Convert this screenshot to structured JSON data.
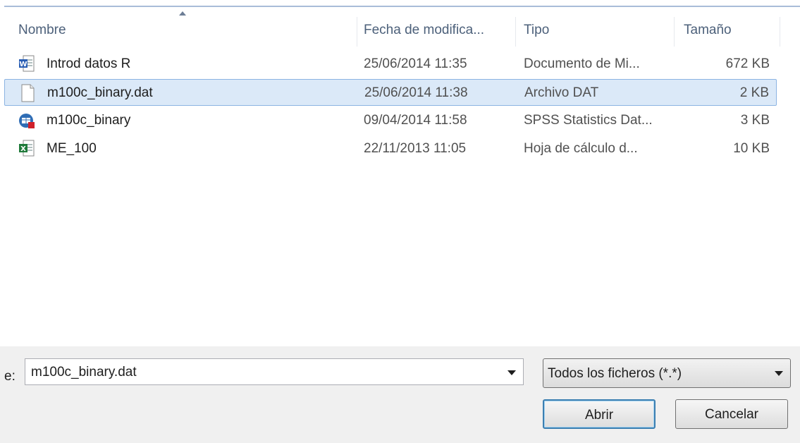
{
  "columns": {
    "name": "Nombre",
    "date": "Fecha de modifica...",
    "type": "Tipo",
    "size": "Tamaño"
  },
  "files": [
    {
      "name": "Introd datos R",
      "date": "25/06/2014 11:35",
      "type": "Documento de Mi...",
      "size": "672 KB",
      "icon": "word-document-icon",
      "selected": false
    },
    {
      "name": "m100c_binary.dat",
      "date": "25/06/2014 11:38",
      "type": "Archivo DAT",
      "size": "2 KB",
      "icon": "blank-file-icon",
      "selected": true
    },
    {
      "name": "m100c_binary",
      "date": "09/04/2014 11:58",
      "type": "SPSS Statistics Dat...",
      "size": "3 KB",
      "icon": "spss-data-icon",
      "selected": false
    },
    {
      "name": "ME_100",
      "date": "22/11/2013 11:05",
      "type": "Hoja de cálculo d...",
      "size": "10 KB",
      "icon": "excel-spreadsheet-icon",
      "selected": false
    }
  ],
  "filename": {
    "label": "e:",
    "value": "m100c_binary.dat"
  },
  "filter": {
    "value": "Todos los ficheros (*.*)"
  },
  "buttons": {
    "open": "Abrir",
    "cancel": "Cancelar"
  },
  "colors": {
    "selection_bg": "#dbe9f8",
    "selection_border": "#8cb4e2",
    "header_text": "#4c607a",
    "default_button_border": "#3c7fb1"
  }
}
